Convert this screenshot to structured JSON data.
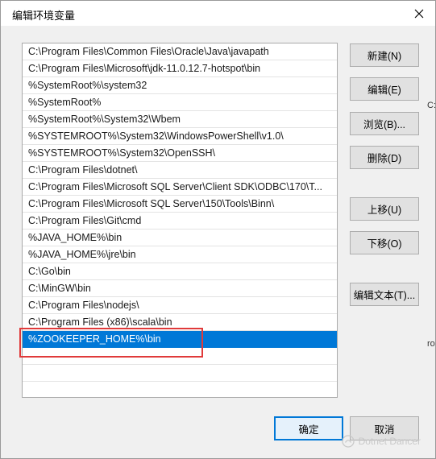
{
  "dialog": {
    "title": "编辑环境变量"
  },
  "path_list": {
    "items": [
      "C:\\Program Files\\Common Files\\Oracle\\Java\\javapath",
      "C:\\Program Files\\Microsoft\\jdk-11.0.12.7-hotspot\\bin",
      "%SystemRoot%\\system32",
      "%SystemRoot%",
      "%SystemRoot%\\System32\\Wbem",
      "%SYSTEMROOT%\\System32\\WindowsPowerShell\\v1.0\\",
      "%SYSTEMROOT%\\System32\\OpenSSH\\",
      "C:\\Program Files\\dotnet\\",
      "C:\\Program Files\\Microsoft SQL Server\\Client SDK\\ODBC\\170\\T...",
      "C:\\Program Files\\Microsoft SQL Server\\150\\Tools\\Binn\\",
      "C:\\Program Files\\Git\\cmd",
      "%JAVA_HOME%\\bin",
      "%JAVA_HOME%\\jre\\bin",
      "C:\\Go\\bin",
      "C:\\MinGW\\bin",
      "C:\\Program Files\\nodejs\\",
      "C:\\Program Files (x86)\\scala\\bin",
      "%ZOOKEEPER_HOME%\\bin"
    ],
    "selected_index": 17
  },
  "buttons": {
    "new": "新建(N)",
    "edit": "编辑(E)",
    "browse": "浏览(B)...",
    "delete": "删除(D)",
    "move_up": "上移(U)",
    "move_down": "下移(O)",
    "edit_text": "编辑文本(T)...",
    "ok": "确定",
    "cancel": "取消"
  },
  "edge_fragments": {
    "a": "C:",
    "b": "ro"
  },
  "watermark": {
    "text": "Dotnet Dancer"
  },
  "colors": {
    "selection": "#0078d7",
    "highlight_box": "#e03a3a",
    "primary_border": "#0078d7"
  }
}
